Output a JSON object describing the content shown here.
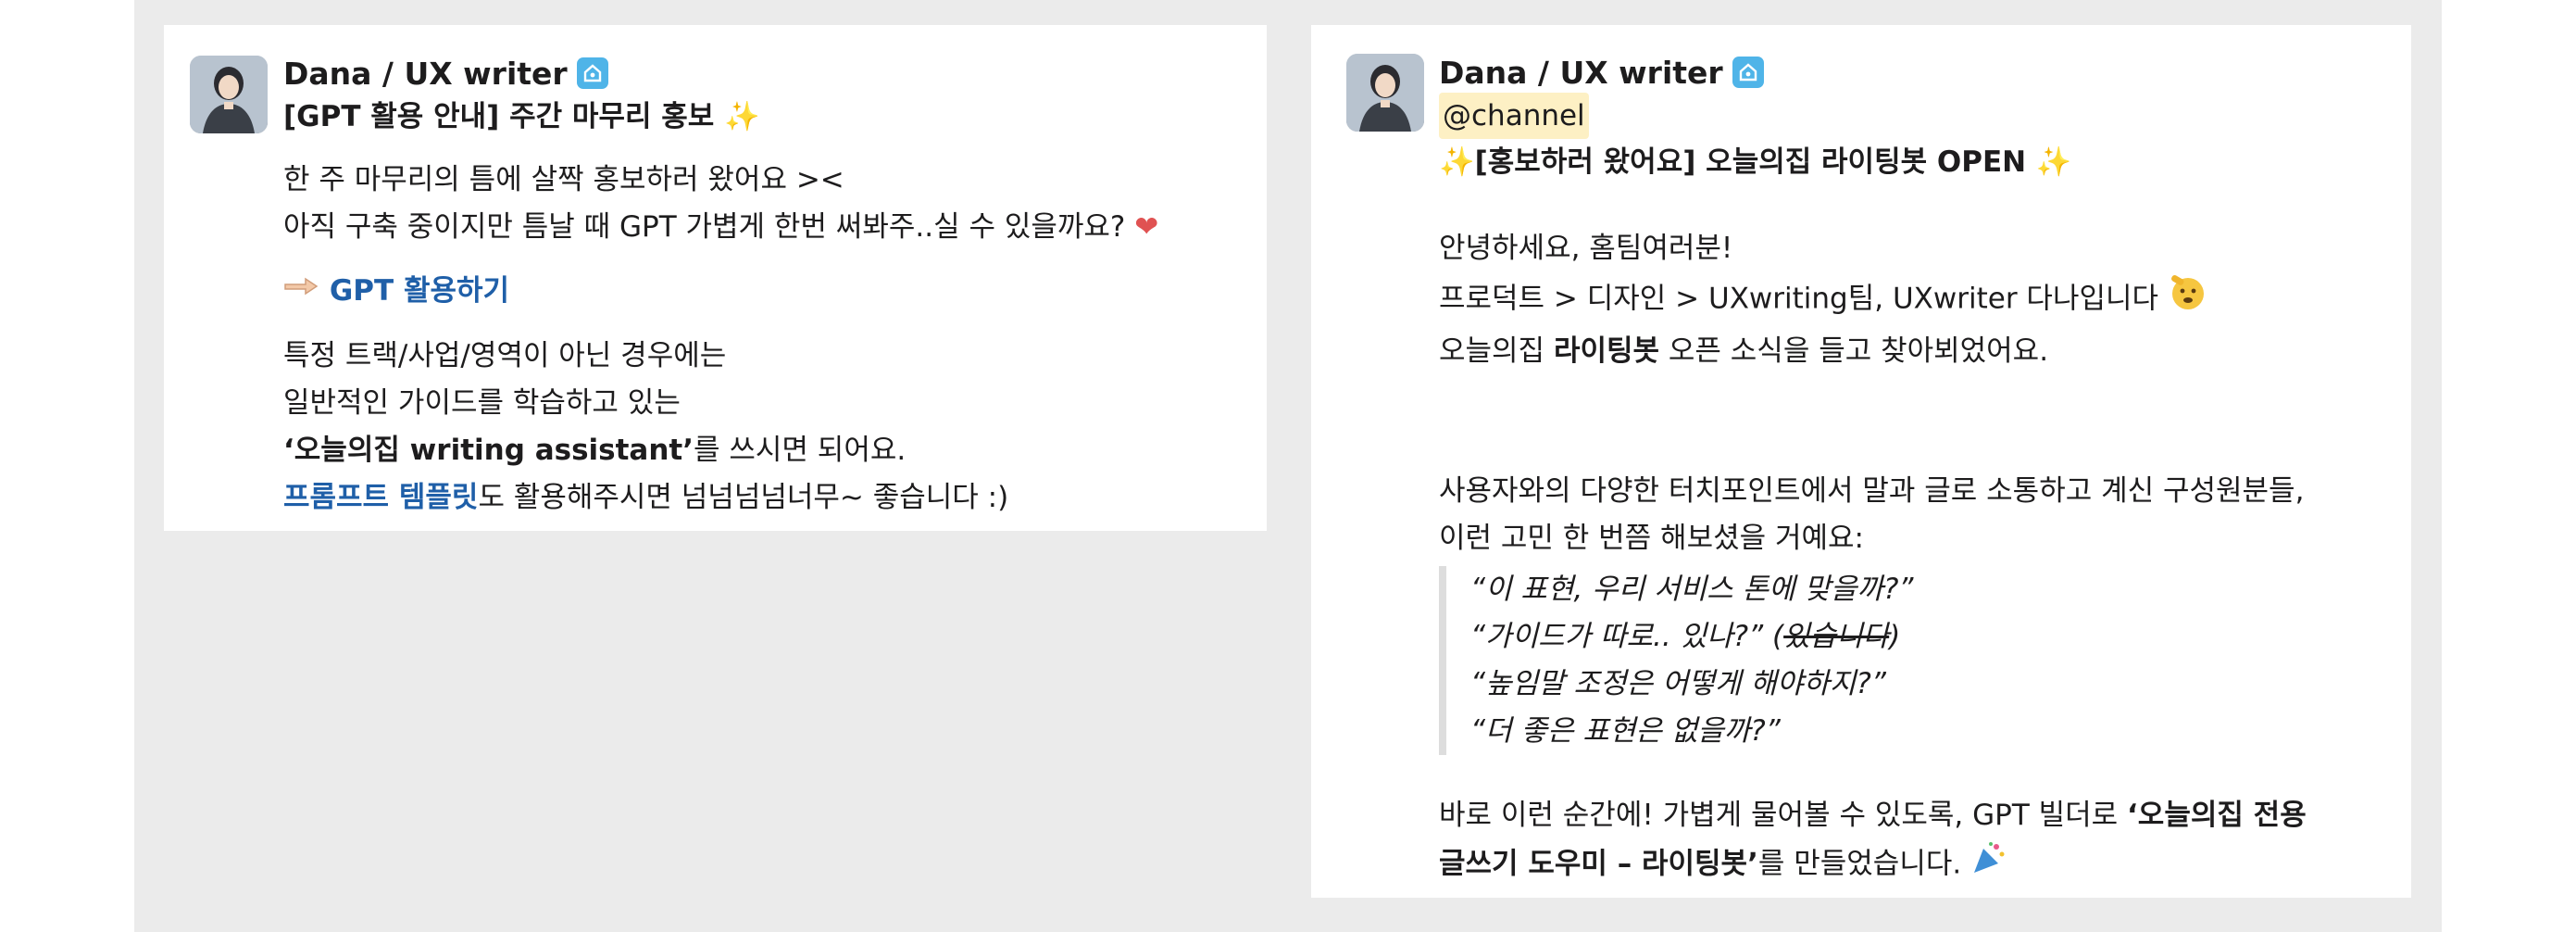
{
  "left_message": {
    "author": "Dana / UX writer",
    "title": "[GPT 활용 안내] 주간 마무리 홍보",
    "title_emoji": "✨",
    "lines": [
      "한 주 마무리의 틈에 살짝 홍보하러 왔어요 ><",
      "아직 구축 중이지만 틈날 때 GPT 가볍게 한번 써봐주..실 수 있을까요?"
    ],
    "heart_emoji": "❤",
    "pointing_emoji": "👉",
    "gpt_link": "GPT 활용하기",
    "info_lines": [
      "특정 트랙/사업/영역이 아닌 경우에는",
      "일반적인 가이드를 학습하고 있는"
    ],
    "assistant_name": "‘오늘의집 writing assistant’",
    "assistant_suffix": "를 쓰시면 되어요.",
    "template_link": "프롬프트 템플릿",
    "template_suffix": "도 활용해주시면 넘넘넘넘너무~ 좋습니다 :)"
  },
  "right_message": {
    "author": "Dana / UX writer",
    "mention": "@channel",
    "title": "[홍보하러 왔어요] 오늘의집 라이팅봇 OPEN",
    "title_emoji": "✨",
    "greeting": "안녕하세요, 홈팀여러분!",
    "intro": "프로덕트 > 디자인 > UXwriting팀, UXwriter 다나입니다",
    "news_prefix": "오늘의집 ",
    "news_bold": "라이팅봇",
    "news_suffix": " 오픈 소식을 들고 찾아뵈었어요.",
    "context_1": "사용자와의 다양한 터치포인트에서 말과 글로 소통하고 계신 구성원분들,",
    "context_2": "이런 고민 한 번쯤 해보셨을 거예요:",
    "quotes": {
      "q1": "“이 표현, 우리 서비스 톤에 맞을까?”",
      "q2": "“가이드가 따로.. 있나?” (",
      "q2_strike": "있습니다",
      "q2_end": ")",
      "q3": "“높임말 조정은 어떻게 해야하지?”",
      "q4": "“더 좋은 표현은 없을까?”"
    },
    "closing_prefix": "바로 이런 순간에! 가볍게 물어볼 수 있도록, GPT 빌더로 ",
    "closing_bold_1": "‘오늘의집 전용",
    "closing_bold_2": "글쓰기 도우미 – 라이팅봇’",
    "closing_suffix": "를 만들었습니다."
  }
}
